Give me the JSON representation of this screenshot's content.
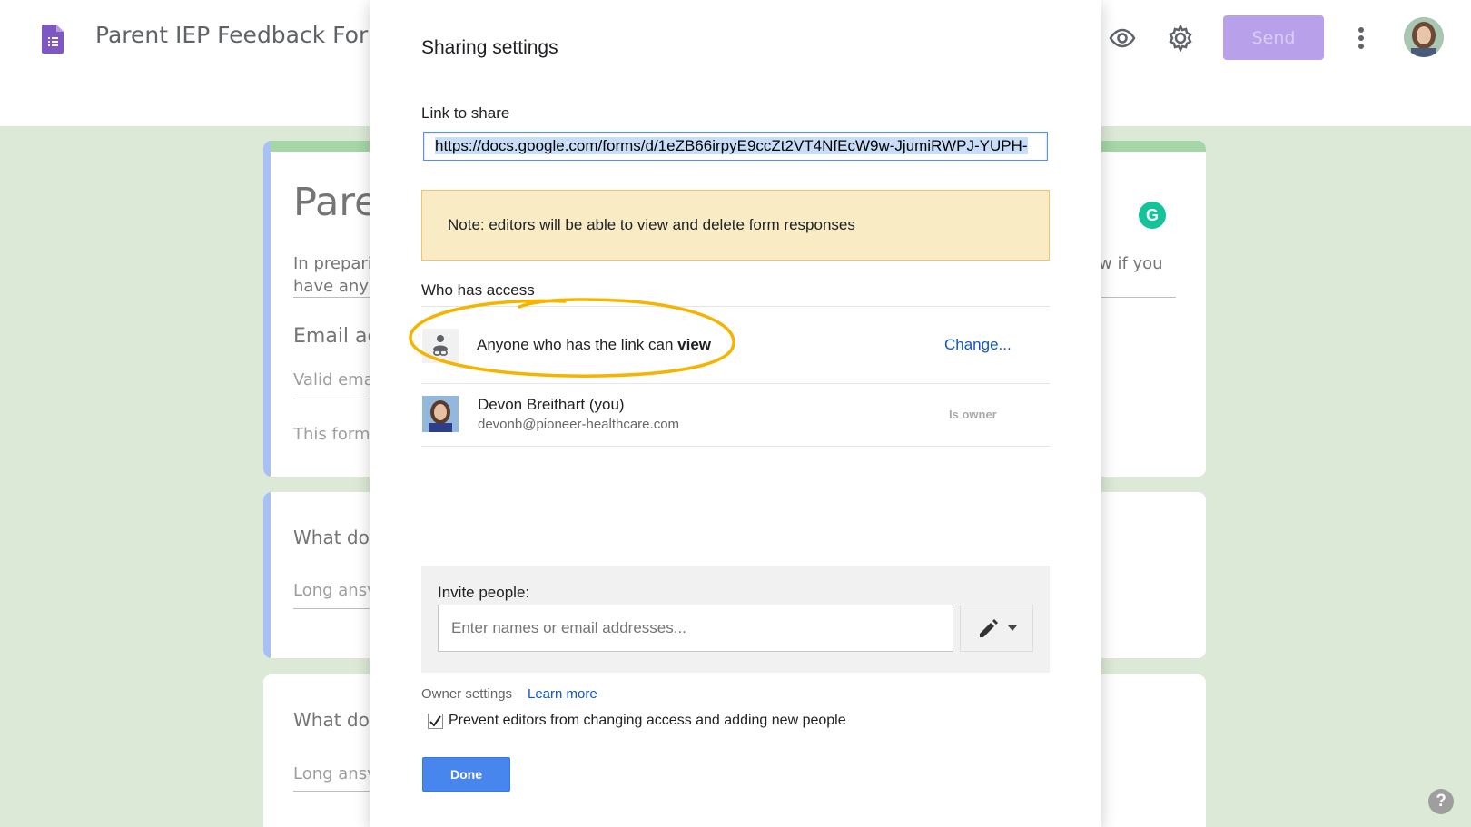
{
  "app": {
    "doc_title": "Parent IEP Feedback For",
    "send_label": "Send",
    "icons": [
      "forms-logo-icon",
      "preview-eye-icon",
      "settings-gear-icon",
      "more-vert-icon"
    ],
    "accent_color": "#b8a0ea"
  },
  "background_form": {
    "title_fragment": "Pare",
    "desc_line1": "In preparin",
    "desc_line2": "have any q",
    "desc_right": "w if you",
    "email_label": "Email ac",
    "email_placeholder": "Valid ema",
    "form_note": "This form",
    "q1": "What do",
    "q1_hint": "Long ansv",
    "q2": "What do",
    "q2_hint": "Long ansv",
    "grammarly_letter": "G",
    "help_glyph": "?"
  },
  "dialog": {
    "title": "Sharing settings",
    "link_label": "Link to share",
    "link_value": "https://docs.google.com/forms/d/1eZB66irpyE9ccZt2VT4NfEcW9w-JjumiRWPJ-YUPH-",
    "note": "Note: editors will be able to view and delete form responses",
    "who_has_access": "Who has access",
    "link_access": {
      "text": "Anyone who has the link can",
      "level": "view",
      "change_label": "Change..."
    },
    "people": [
      {
        "name": "Devon Breithart (you)",
        "email": "devonb@pioneer-healthcare.com",
        "role": "Is owner"
      }
    ],
    "invite": {
      "label": "Invite people:",
      "placeholder": "Enter names or email addresses..."
    },
    "owner_settings": {
      "label": "Owner settings",
      "learn_more": "Learn more",
      "prevent_label": "Prevent editors from changing access and adding new people",
      "prevent_checked": true
    },
    "done_label": "Done",
    "highlight_color": "#f5b400"
  }
}
